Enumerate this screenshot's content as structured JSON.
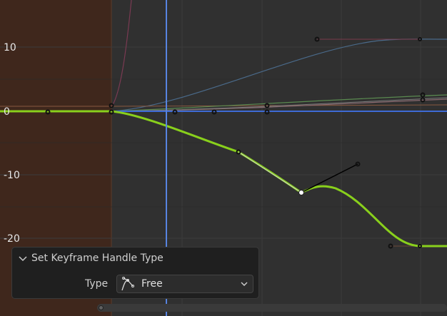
{
  "y_axis": {
    "labels": [
      "10",
      "0",
      "-10",
      "-20"
    ]
  },
  "redo_panel": {
    "title": "Set Keyframe Handle Type",
    "type_label": "Type",
    "type_value": "Free",
    "icons": {
      "collapse": "chevron-down-icon",
      "handle_type": "handle-free-icon",
      "dropdown": "chevron-down-icon"
    }
  },
  "colors": {
    "background": "#303030",
    "out_of_range": "#3f271c",
    "active_curve": "#89d01c",
    "playhead": "#5784e0",
    "panel": "#1f1f1f"
  }
}
